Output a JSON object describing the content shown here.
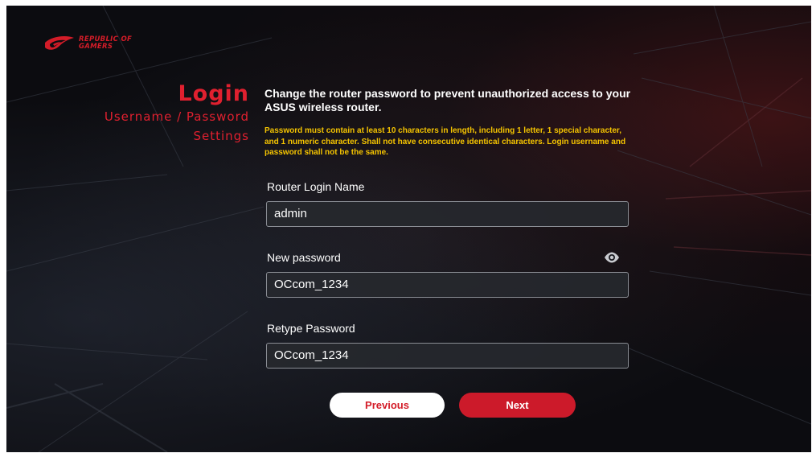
{
  "brand": {
    "logo_text_line1": "REPUBLIC OF",
    "logo_text_line2": "GAMERS",
    "accent_color": "#d31c28",
    "warning_color": "#f5c400"
  },
  "nav": {
    "title": "Login",
    "subtitle_line1": "Username / Password",
    "subtitle_line2": "Settings"
  },
  "main": {
    "heading": "Change the router password to prevent unauthorized access to your ASUS wireless router.",
    "rules": "Password must contain at least 10 characters in length, including 1 letter, 1 special character, and 1 numeric character. Shall not have consecutive identical characters. Login username and password shall not be the same."
  },
  "form": {
    "login_name_label": "Router Login Name",
    "login_name_value": "admin",
    "new_password_label": "New password",
    "new_password_value": "OCcom_1234",
    "retype_password_label": "Retype Password",
    "retype_password_value": "OCcom_1234",
    "show_password_icon": "eye-icon"
  },
  "buttons": {
    "previous_label": "Previous",
    "next_label": "Next"
  }
}
